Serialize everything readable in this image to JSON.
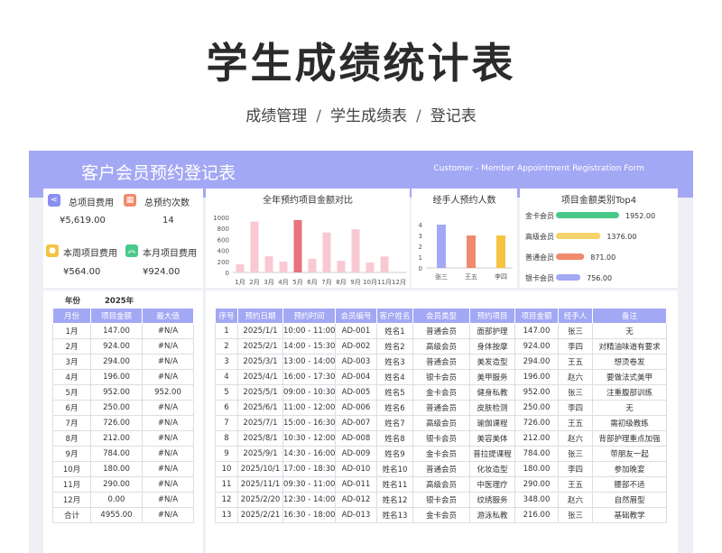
{
  "page": {
    "title": "学生成绩统计表",
    "breadcrumb": [
      "成绩管理",
      "学生成绩表",
      "登记表"
    ],
    "separator": "/"
  },
  "banner": {
    "title": "客户会员预约登记表",
    "subtitle": "Customer - Member Appointment Registration Form"
  },
  "kpis": [
    {
      "label": "总项目费用",
      "value": "¥5,619.00",
      "icon": "share-icon",
      "color": "#8a8ff0"
    },
    {
      "label": "总预约次数",
      "value": "14",
      "icon": "calendar-icon",
      "color": "#f08a6c"
    },
    {
      "label": "本周项目费用",
      "value": "¥564.00",
      "icon": "coin-icon",
      "color": "#f5c342"
    },
    {
      "label": "本月项目费用",
      "value": "¥924.00",
      "icon": "chevrons-up-icon",
      "color": "#47c98a"
    }
  ],
  "chart_data": [
    {
      "type": "bar",
      "title": "全年预约项目金额对比",
      "categories": [
        "1月",
        "2月",
        "3月",
        "4月",
        "5月",
        "6月",
        "7月",
        "8月",
        "9月",
        "10月",
        "11月",
        "12月"
      ],
      "values": [
        147,
        924,
        294,
        196,
        952,
        250,
        726,
        212,
        784,
        180,
        290,
        0
      ],
      "ylim": [
        0,
        1000
      ],
      "yticks": [
        "0",
        "200",
        "400",
        "600",
        "800",
        "1000"
      ],
      "highlight_index": 4,
      "colors": {
        "bar": "#f9c9d3",
        "highlight": "#e8727f"
      }
    },
    {
      "type": "bar",
      "title": "经手人预约人数",
      "categories": [
        "张三",
        "王五",
        "李四"
      ],
      "values": [
        4,
        3,
        3
      ],
      "ylim": [
        0,
        4
      ],
      "yticks": [
        "0",
        "1",
        "2",
        "3",
        "4"
      ],
      "colors": [
        "#a3a8f4",
        "#f08a6c",
        "#f5c342"
      ]
    },
    {
      "type": "bar",
      "orientation": "horizontal",
      "title": "项目金额类别Top4",
      "categories": [
        "金卡会员",
        "高级会员",
        "普通会员",
        "银卡会员"
      ],
      "values": [
        1952,
        1376,
        871,
        756
      ],
      "labels": [
        "1952.00",
        "1376.00",
        "871.00",
        "756.00"
      ],
      "colors": [
        "#47c98a",
        "#f5d36b",
        "#f08a6c",
        "#a3a8f4"
      ]
    }
  ],
  "monthly": {
    "year_label": "年份",
    "year": "2025年",
    "headers": [
      "月份",
      "项目金额",
      "最大值"
    ],
    "rows": [
      [
        "1月",
        "147.00",
        "#N/A"
      ],
      [
        "2月",
        "924.00",
        "#N/A"
      ],
      [
        "3月",
        "294.00",
        "#N/A"
      ],
      [
        "4月",
        "196.00",
        "#N/A"
      ],
      [
        "5月",
        "952.00",
        "952.00"
      ],
      [
        "6月",
        "250.00",
        "#N/A"
      ],
      [
        "7月",
        "726.00",
        "#N/A"
      ],
      [
        "8月",
        "212.00",
        "#N/A"
      ],
      [
        "9月",
        "784.00",
        "#N/A"
      ],
      [
        "10月",
        "180.00",
        "#N/A"
      ],
      [
        "11月",
        "290.00",
        "#N/A"
      ],
      [
        "12月",
        "0.00",
        "#N/A"
      ],
      [
        "合计",
        "4955.00",
        "#N/A"
      ]
    ]
  },
  "records": {
    "headers": [
      "序号",
      "预约日期",
      "预约时间",
      "会员编号",
      "客户姓名",
      "会员类型",
      "预约项目",
      "项目金额",
      "经手人",
      "备注"
    ],
    "rows": [
      [
        "1",
        "2025/1/1",
        "10:00 - 11:00",
        "AD-001",
        "姓名1",
        "普通会员",
        "面部护理",
        "147.00",
        "张三",
        "无"
      ],
      [
        "2",
        "2025/2/1",
        "14:00 - 15:30",
        "AD-002",
        "姓名2",
        "高级会员",
        "身体按摩",
        "924.00",
        "李四",
        "对精油味道有要求"
      ],
      [
        "3",
        "2025/3/1",
        "13:00 - 14:00",
        "AD-003",
        "姓名3",
        "普通会员",
        "美发造型",
        "294.00",
        "王五",
        "想烫卷发"
      ],
      [
        "4",
        "2025/4/1",
        "16:00 - 17:30",
        "AD-004",
        "姓名4",
        "银卡会员",
        "美甲服务",
        "196.00",
        "赵六",
        "要做法式美甲"
      ],
      [
        "5",
        "2025/5/1",
        "09:00 - 10:30",
        "AD-005",
        "姓名5",
        "金卡会员",
        "健身私教",
        "952.00",
        "张三",
        "注重腹部训练"
      ],
      [
        "6",
        "2025/6/1",
        "11:00 - 12:00",
        "AD-006",
        "姓名6",
        "普通会员",
        "皮肤检测",
        "250.00",
        "李四",
        "无"
      ],
      [
        "7",
        "2025/7/1",
        "15:00 - 16:30",
        "AD-007",
        "姓名7",
        "高级会员",
        "瑜伽课程",
        "726.00",
        "王五",
        "需初级教练"
      ],
      [
        "8",
        "2025/8/1",
        "10:30 - 12:00",
        "AD-008",
        "姓名8",
        "银卡会员",
        "美容美体",
        "212.00",
        "赵六",
        "背部护理重点加强"
      ],
      [
        "9",
        "2025/9/1",
        "14:30 - 16:00",
        "AD-009",
        "姓名9",
        "金卡会员",
        "普拉提课程",
        "784.00",
        "张三",
        "带朋友一起"
      ],
      [
        "10",
        "2025/10/1",
        "17:00 - 18:30",
        "AD-010",
        "姓名10",
        "普通会员",
        "化妆造型",
        "180.00",
        "李四",
        "参加晚宴"
      ],
      [
        "11",
        "2025/11/1",
        "09:30 - 11:00",
        "AD-011",
        "姓名11",
        "高级会员",
        "中医理疗",
        "290.00",
        "王五",
        "腰部不适"
      ],
      [
        "12",
        "2025/2/20",
        "12:30 - 14:00",
        "AD-012",
        "姓名12",
        "银卡会员",
        "纹绣服务",
        "348.00",
        "赵六",
        "自然眉型"
      ],
      [
        "13",
        "2025/2/21",
        "16:30 - 18:00",
        "AD-013",
        "姓名13",
        "金卡会员",
        "游泳私教",
        "216.00",
        "张三",
        "基础教学"
      ]
    ]
  }
}
